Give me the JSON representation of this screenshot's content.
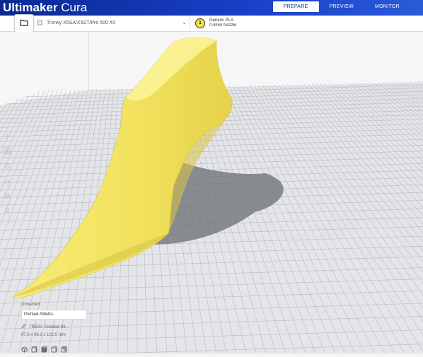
{
  "app": {
    "brand_bold": "Ultimaker",
    "brand_light": " Cura"
  },
  "stages": [
    {
      "label": "PREPARE",
      "active": true
    },
    {
      "label": "PREVIEW",
      "active": false
    },
    {
      "label": "MONITOR",
      "active": false
    }
  ],
  "printer": {
    "name": "Tronxy X5SA/X5ST/Pro 500 #3"
  },
  "material": {
    "extruder_number": "1",
    "name": "Generic PLA",
    "nozzle": "0.4mm Nozzle"
  },
  "object_list": {
    "header": "Unnamed",
    "job_name": "Pointed-Stiletto",
    "printer_prefix": "TR500",
    "object_name": "Pointed-Sti...",
    "dimensions": "67.8 x 98.2 x 102.5 mm"
  },
  "colors": {
    "header_blue": "#0a2a93",
    "model_yellow": "#f4e86a",
    "grid_line": "#bcbec4"
  },
  "icons": [
    "folder-icon",
    "printer-icon",
    "chevron-down-icon",
    "move-icon",
    "scale-icon",
    "rotate-icon",
    "mirror-icon",
    "per-model-settings-icon",
    "support-blocker-icon",
    "edit-icon",
    "view-3d-icon",
    "view-front-icon",
    "view-top-icon",
    "view-left-icon",
    "view-right-icon"
  ]
}
